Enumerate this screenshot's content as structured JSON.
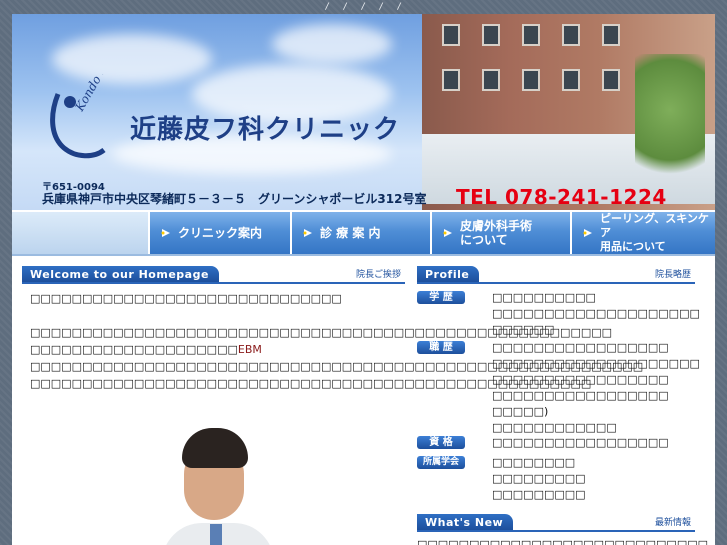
{
  "topnav": {
    "separators": [
      "/",
      "/",
      "/",
      "/",
      "/"
    ]
  },
  "header": {
    "logo_text": "Kondo clinic",
    "clinic_name": "近藤皮フ科クリニック",
    "zip": "〒651-0094",
    "address": "兵庫県神戸市中央区琴緒町５－３－５　グリーンシャポービル312号室",
    "tel": "TEL 078-241-1224",
    "colors": {
      "primary": "#1e3f86",
      "tel": "#e60012",
      "nav": "#3475c5"
    }
  },
  "nav": [
    {
      "label": "クリニック案内",
      "icon": "arrow-icon"
    },
    {
      "label": "診 療 案 内",
      "icon": "arrow-icon"
    },
    {
      "label": "皮膚外科手術\nについて",
      "icon": "arrow-icon"
    },
    {
      "label": "ピーリング、スキンケア\n用品について",
      "icon": "arrow-icon"
    }
  ],
  "welcome": {
    "title": "Welcome to our Homepage",
    "subtitle": "院長ご挨拶",
    "paragraphs": [
      "□□□□□□□□□□□□□□□□□□□□□□□□□□□□□□",
      "□□□□□□□□□□□□□□□□□□□□□□□□□□□□□□□□□□□□□□□□□□□□□□□□□□□□□□□□",
      "□□□□□□□□□□□□□□□□□□□□",
      "□□□□□□□□□□□□□□□□□□□□□□□□□□□□□□□□□□□□□□□□□□□□□□□□□□□□□□□□□□□",
      "□□□□□□□□□□□□□□□□□□□□□□□□□□□□□□□□□□□□□□□□□□□□□□□□□□□□□□"
    ],
    "ebm_label": "EBM"
  },
  "profile": {
    "title": "Profile",
    "subtitle": "院長略歴",
    "sections": [
      {
        "badge": "学 歴",
        "lines": [
          "□□□□□□□□□□",
          "□□□□□□□□□□□□□□□□□□□□",
          "□□□□□□"
        ]
      },
      {
        "badge": "職 歴",
        "lines": [
          "□□□□□□□□□□□□□□□□□",
          "□□□□□□□□□□□□□□□□□□□□",
          "□□□□□□□□□□□□□□□□□",
          "□□□□□□□□□□□□□□□□□",
          "□□□□□)",
          "□□□□□□□□□□□□"
        ]
      },
      {
        "badge": "資 格",
        "lines": [
          "□□□□□□□□□□□□□□□□□"
        ]
      },
      {
        "badge": "所属学会",
        "lines": [
          "□□□□□□□□",
          "□□□□□□□□□",
          "□□□□□□□□□"
        ]
      }
    ]
  },
  "news": {
    "title": "What's New",
    "subtitle": "最新情報",
    "first_line": "□□□□□□□□□□□□□□□□□□□□□□□□□□□□"
  }
}
